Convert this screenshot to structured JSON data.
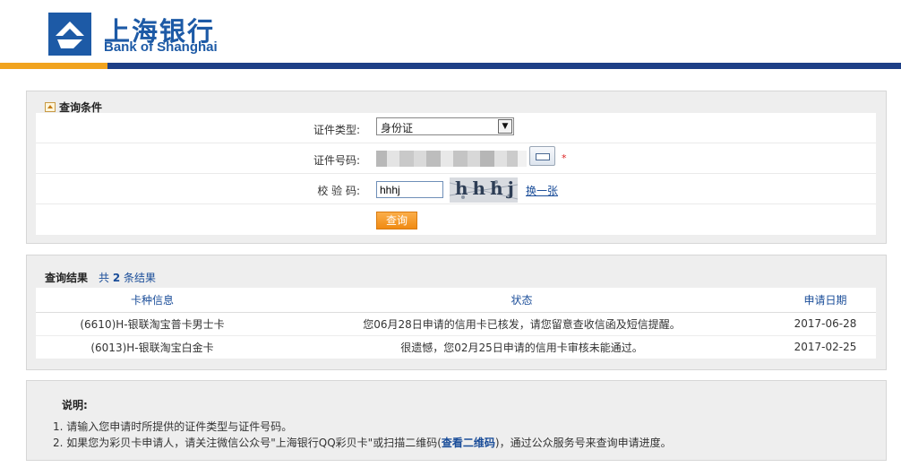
{
  "header": {
    "logo_cn": "上海银行",
    "logo_en": "Bank of Shanghai"
  },
  "query": {
    "section_title": "查询条件",
    "id_type_label": "证件类型:",
    "id_type_value": "身份证",
    "id_number_label": "证件号码:",
    "required_mark": "*",
    "captcha_label": "校 验 码:",
    "captcha_value": "hhhj",
    "captcha_image_text": "hhhj",
    "refresh_label": "换一张",
    "submit_label": "查询"
  },
  "results": {
    "section_title": "查询结果",
    "count_prefix": "共",
    "count": "2",
    "count_suffix": "条结果",
    "columns": [
      "卡种信息",
      "状态",
      "申请日期"
    ],
    "rows": [
      {
        "card": "(6610)H-银联淘宝普卡男士卡",
        "status": "您06月28日申请的信用卡已核发，请您留意查收信函及短信提醒。",
        "date": "2017-06-28"
      },
      {
        "card": "(6013)H-银联淘宝白金卡",
        "status": "很遗憾，您02月25日申请的信用卡审核未能通过。",
        "date": "2017-02-25"
      }
    ]
  },
  "notes": {
    "title": "说明:",
    "line1": "1. 请输入您申请时所提供的证件类型与证件号码。",
    "line2_before": "2. 如果您为彩贝卡申请人，请关注微信公众号\"上海银行QQ彩贝卡\"或扫描二维码(",
    "line2_link": "查看二维码",
    "line2_after": ")，通过公众服务号来查询申请进度。"
  },
  "colors": {
    "brand_blue": "#1d3f86",
    "brand_orange": "#f1a31e",
    "link_blue": "#1a4d99",
    "button_orange": "#f08a12"
  }
}
